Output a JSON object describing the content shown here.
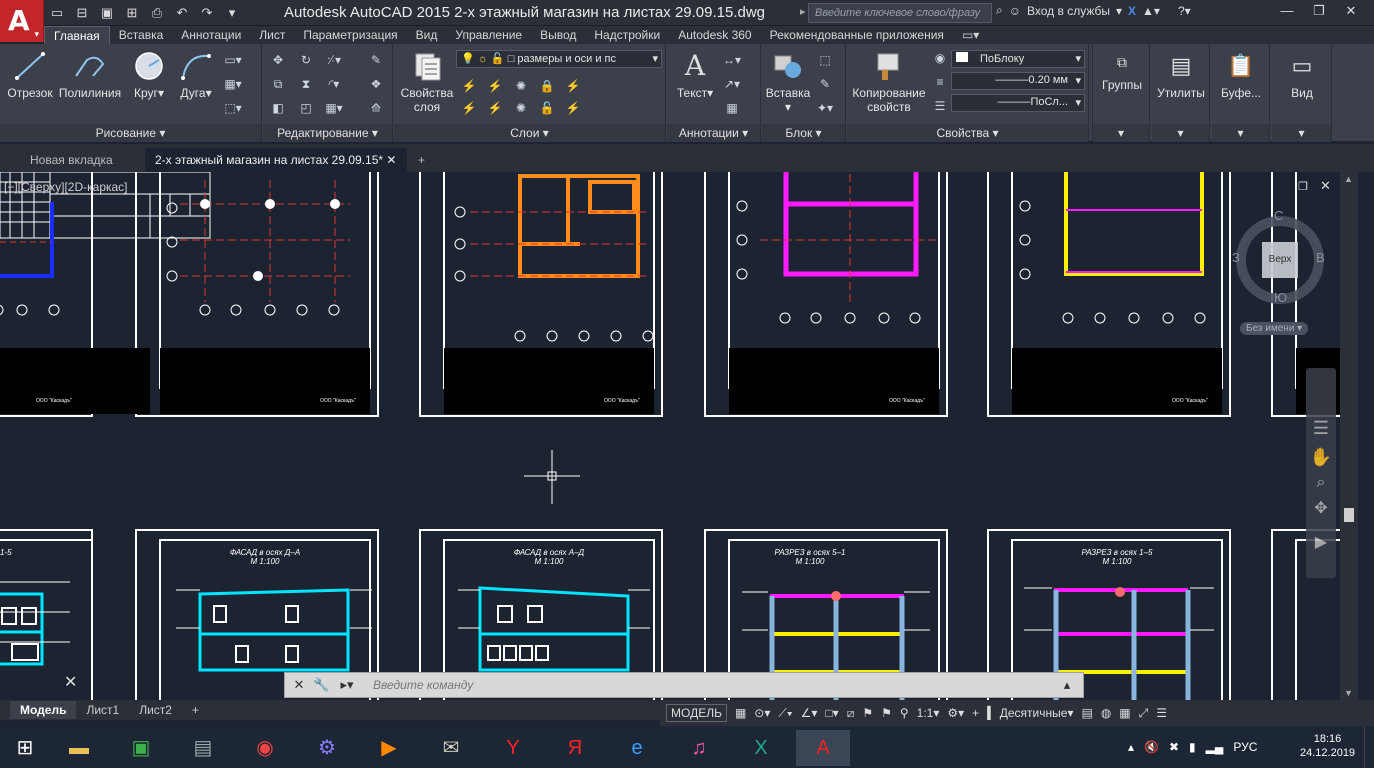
{
  "app": {
    "logo": "A",
    "title": "Autodesk AutoCAD 2015    2-х этажный магазин на листах 29.09.15.dwg"
  },
  "quick_access": [
    "new-icon",
    "open-icon",
    "save-icon",
    "saveas-icon",
    "print-icon",
    "undo-icon",
    "redo-icon",
    "dropdown-icon"
  ],
  "search": {
    "placeholder": "Введите ключевое слово/фразу"
  },
  "signin": {
    "label": "Вход в службы"
  },
  "ribbon_tabs": [
    "Главная",
    "Вставка",
    "Аннотации",
    "Лист",
    "Параметризация",
    "Вид",
    "Управление",
    "Вывод",
    "Надстройки",
    "Autodesk 360",
    "Рекомендованные приложения"
  ],
  "panels": {
    "draw": {
      "label": "Рисование",
      "tools": [
        "Отрезок",
        "Полилиния",
        "Круг",
        "Дуга"
      ]
    },
    "modify": {
      "label": "Редактирование"
    },
    "layers": {
      "label": "Слои",
      "properties": [
        "Свойства",
        "слоя"
      ],
      "current_layer": "размеры и оси и пс"
    },
    "annotations": {
      "label": "Аннотации",
      "text": "Текст"
    },
    "block": {
      "label": "Блок",
      "insert": "Вставка"
    },
    "properties": {
      "label": "Свойства",
      "copy": [
        "Копирование",
        "свойств"
      ],
      "color": "ПоБлоку",
      "lineweight": "0.20 мм",
      "linetype": "ПоСл..."
    },
    "groups": {
      "label": "Группы"
    },
    "utilities": {
      "label": "Утилиты"
    },
    "clipboard": {
      "label": "Буфе..."
    },
    "view": {
      "label": "Вид"
    }
  },
  "doc_tabs": [
    "Новая вкладка",
    "2-х этажный магазин на листах 29.09.15*"
  ],
  "viewport_label": "[−][Сверху][2D-каркас]",
  "viewcube": {
    "top": "Верх",
    "n": "С",
    "w": "З",
    "e": "В",
    "s": "Ю",
    "ucs": "Без имени"
  },
  "sheets": {
    "top": [
      {
        "stamp": "ООО \"Каскадъ\""
      },
      {
        "stamp": "ООО \"Каскадъ\""
      },
      {
        "stamp": "ООО \"Каскадъ\""
      },
      {
        "stamp": "ООО \"Каскадъ\""
      },
      {
        "stamp": "ООО \"Каскадъ\""
      }
    ],
    "bottom": [
      {
        "title": "1-5",
        "scale": ""
      },
      {
        "title": "ФАСАД в осях Д–А",
        "scale": "М 1:100"
      },
      {
        "title": "ФАСАД в осях А–Д",
        "scale": "М 1:100"
      },
      {
        "title": "РАЗРЕЗ в осях 5–1",
        "scale": "М 1:100"
      },
      {
        "title": "РАЗРЕЗ в осях 1–5",
        "scale": "М 1:100"
      }
    ]
  },
  "command": {
    "placeholder": "Введите команду"
  },
  "layout_tabs": [
    "Модель",
    "Лист1",
    "Лист2"
  ],
  "status": {
    "model": "МОДЕЛЬ",
    "scale": "1:1",
    "units": "Десятичные"
  },
  "taskbar": {
    "lang": "РУС",
    "time": "18:16",
    "date": "24.12.2019"
  },
  "colors": {
    "accent": "#c2262b",
    "canvas": "#1d2431",
    "ribbon": "#3b404a"
  }
}
